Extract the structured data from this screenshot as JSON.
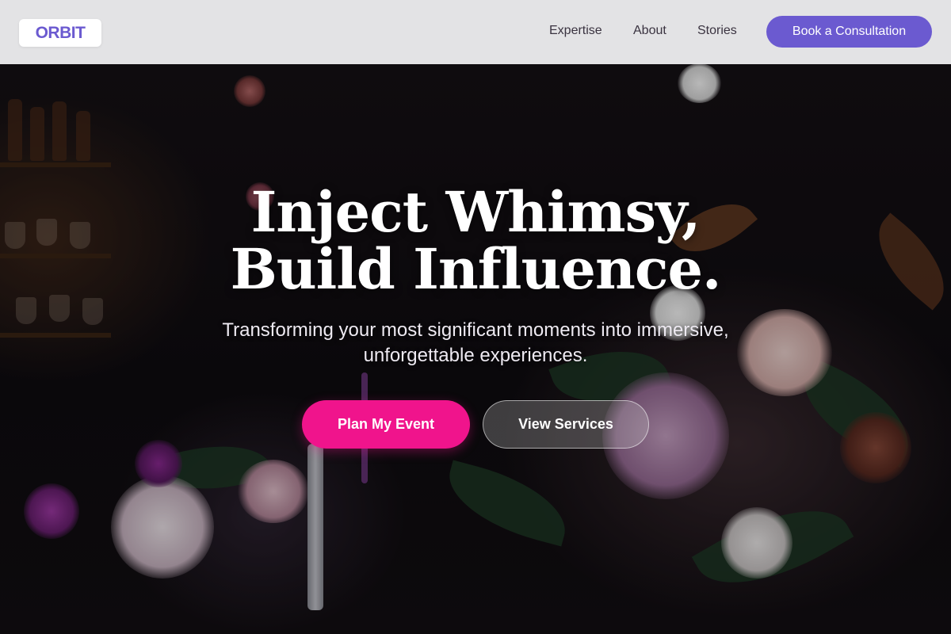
{
  "header": {
    "logo": "ORBIT",
    "nav": [
      {
        "label": "Expertise"
      },
      {
        "label": "About"
      },
      {
        "label": "Stories"
      }
    ],
    "cta_label": "Book a Consultation"
  },
  "hero": {
    "title_line1": "Inject Whimsy,",
    "title_line2": "Build Influence.",
    "subtitle": "Transforming your most significant moments into immersive, unforgettable experiences.",
    "primary_button": "Plan My Event",
    "secondary_button": "View Services",
    "background_image": "dark floral event tablescape with candles"
  },
  "colors": {
    "brand": "#6b5ad0",
    "primary_cta": "#f0148c",
    "header_bg": "#ececee"
  }
}
